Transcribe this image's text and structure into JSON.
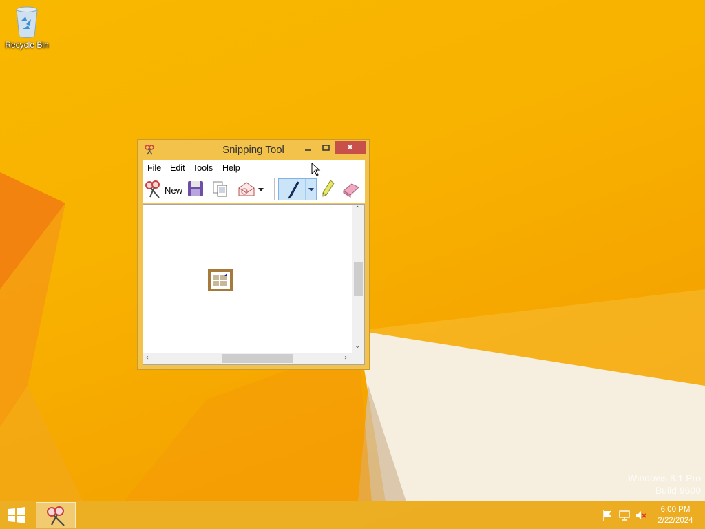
{
  "desktop": {
    "icons": [
      {
        "label": "Recycle Bin",
        "icon": "recycle-bin-icon"
      }
    ],
    "watermark": {
      "line1": "Windows 8.1 Pro",
      "line2": "Build 9600"
    }
  },
  "window": {
    "title": "Snipping Tool",
    "icon": "scissors-icon",
    "controls": {
      "minimize": "minimize-icon",
      "maximize": "maximize-icon",
      "close": "close-icon"
    },
    "menu": [
      "File",
      "Edit",
      "Tools",
      "Help"
    ],
    "toolbar": {
      "new_label": "New",
      "tools": [
        "save-icon",
        "copy-icon",
        "send-snip-icon",
        "pen-icon",
        "highlighter-icon",
        "eraser-icon"
      ]
    }
  },
  "taskbar": {
    "clock_time": "6:00 PM",
    "clock_date": "2/22/2024",
    "tray": [
      "action-center-flag-icon",
      "network-icon",
      "volume-muted-icon"
    ]
  },
  "colors": {
    "accent": "#f9b800",
    "close_button": "#c7504b",
    "window_frame": "#f3c24a",
    "selected_tool": "#cbe4f8"
  }
}
